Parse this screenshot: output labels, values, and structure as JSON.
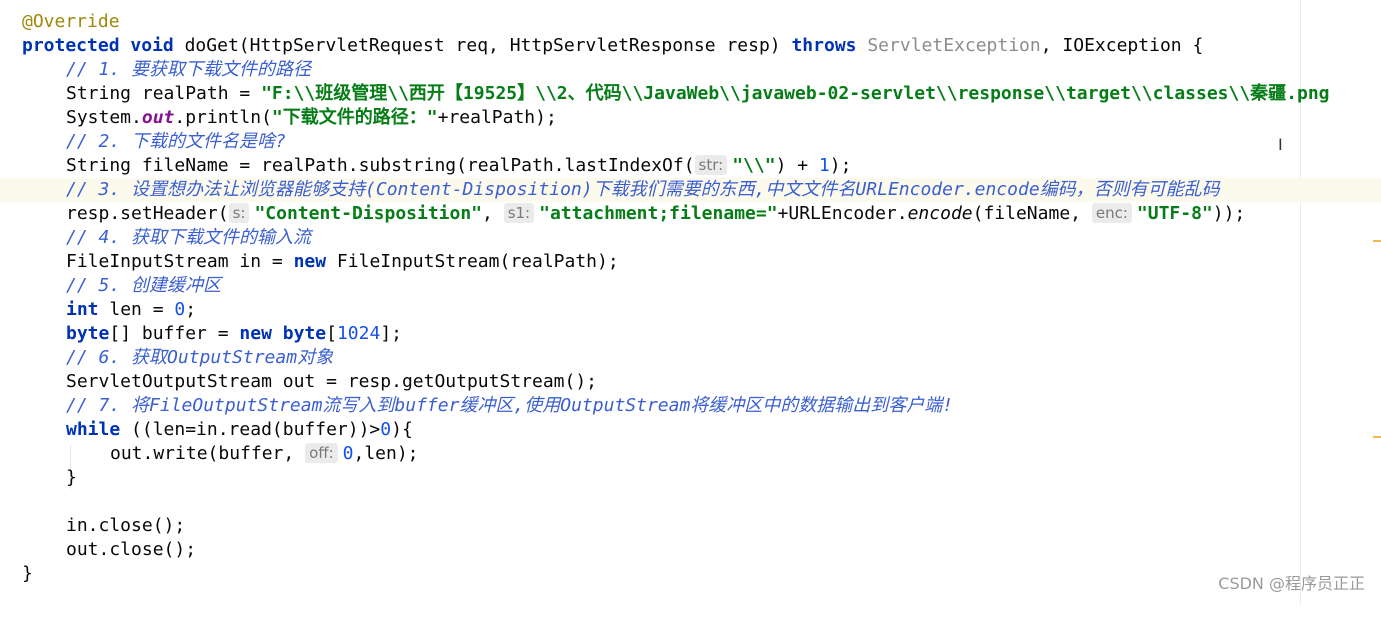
{
  "code": {
    "annotation": "@Override",
    "kw_protected": "protected",
    "kw_void": "void",
    "method_sig": "doGet(HttpServletRequest req, HttpServletResponse resp)",
    "kw_throws": "throws",
    "exc_servlet": "ServletException",
    "exc_io": ", IOException {",
    "c1": "// 1. 要获取下载文件的路径",
    "l3_a": "String realPath = ",
    "l3_str": "\"F:\\\\班级管理\\\\西开【19525】\\\\2、代码\\\\JavaWeb\\\\javaweb-02-servlet\\\\response\\\\target\\\\classes\\\\秦疆.png",
    "l4_a": "System.",
    "l4_field": "out",
    "l4_b": ".println(",
    "l4_str": "\"下载文件的路径：\"",
    "l4_c": "+realPath);",
    "c2": "// 2. 下载的文件名是啥?",
    "l6_a": "String fileName = realPath.substring(realPath.lastIndexOf(",
    "hint_str": "str:",
    "l6_str": "\"\\\\\"",
    "l6_b": ") + ",
    "l6_num": "1",
    "l6_c": ");",
    "c3": "// 3. 设置想办法让浏览器能够支持(Content-Disposition)下载我们需要的东西,中文文件名URLEncoder.encode编码，否则有可能乱码",
    "l8_a": "resp.setHeader(",
    "hint_s": "s:",
    "l8_str1": "\"Content-Disposition\"",
    "l8_comma": ", ",
    "hint_s1": "s1:",
    "l8_str2": "\"attachment;filename=\"",
    "l8_b": "+URLEncoder.",
    "l8_encode": "encode",
    "l8_c": "(fileName, ",
    "hint_enc": "enc:",
    "l8_str3": "\"UTF-8\"",
    "l8_d": "));",
    "c4": "// 4. 获取下载文件的输入流",
    "l10_a": "FileInputStream in = ",
    "kw_new": "new",
    "l10_b": " FileInputStream(realPath);",
    "c5": "// 5. 创建缓冲区",
    "kw_int": "int",
    "l12_a": " len = ",
    "l12_num": "0",
    "l12_b": ";",
    "kw_byte": "byte",
    "l13_a": "[] buffer = ",
    "l13_b": "[",
    "l13_num": "1024",
    "l13_c": "];",
    "c6": "// 6. 获取OutputStream对象",
    "l15": "ServletOutputStream out = resp.getOutputStream();",
    "c7": "// 7. 将FileOutputStream流写入到buffer缓冲区,使用OutputStream将缓冲区中的数据输出到客户端!",
    "kw_while": "while",
    "l17_a": " ((len=in.read(buffer))>",
    "l17_num": "0",
    "l17_b": "){",
    "l18_a": "out.write(buffer, ",
    "hint_off": "off:",
    "l18_num": "0",
    "l18_b": ",len);",
    "brace_close_inner": "}",
    "l21": "in.close();",
    "l22": "out.close();",
    "brace_close_outer": "}"
  },
  "watermark": "CSDN @程序员正正",
  "colors": {
    "keyword": "#0033b3",
    "string": "#067d17",
    "number": "#1750eb",
    "comment": "#3b5fd0",
    "annotation": "#9e880d",
    "highlight_line": "#fcfaed"
  }
}
